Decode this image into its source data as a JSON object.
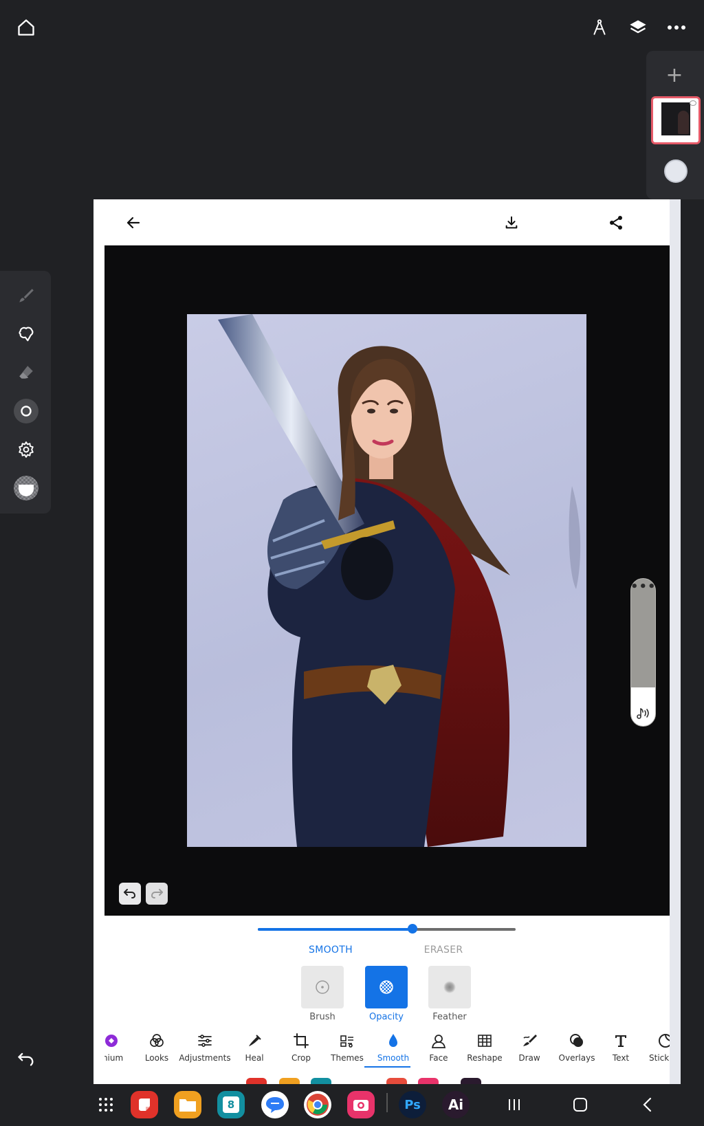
{
  "app": {
    "colors": {
      "accent": "#1473e6",
      "frame_bg": "#202124",
      "panel_bg": "#2b2c30",
      "thumb_border": "#e65a68"
    }
  },
  "top_bar": {
    "icons": [
      "home-icon",
      "compass-icon",
      "layers-icon",
      "more-icon"
    ]
  },
  "layer_panel": {
    "add_label": "+",
    "icons": [
      "plus-icon",
      "layer-thumbnail",
      "color-circle"
    ]
  },
  "left_tools": {
    "icons": [
      "brush-icon",
      "smudge-icon",
      "eraser-icon",
      "brush-size-icon",
      "settings-icon",
      "opacity-icon"
    ],
    "undo_icon": "undo-icon"
  },
  "editor": {
    "header_icons": [
      "back-arrow-icon",
      "download-icon",
      "share-icon"
    ],
    "history_icons": [
      "undo-icon",
      "redo-icon"
    ],
    "side_slider": {
      "menu_label": "•••",
      "level": 0.26,
      "icon": "sound-icon"
    },
    "smooth_slider": {
      "value": 0.6
    },
    "modes": {
      "smooth": "SMOOTH",
      "eraser": "ERASER",
      "selected": "smooth"
    },
    "options": [
      {
        "label": "Brush",
        "icon": "brush-circle-icon"
      },
      {
        "label": "Opacity",
        "icon": "opacity-checker-icon"
      },
      {
        "label": "Feather",
        "icon": "feather-dot-icon"
      }
    ],
    "selected_option": "Opacity",
    "tools": [
      {
        "label": "mium",
        "icon": "premium-icon"
      },
      {
        "label": "Looks",
        "icon": "looks-icon"
      },
      {
        "label": "Adjustments",
        "icon": "adjustments-icon"
      },
      {
        "label": "Heal",
        "icon": "heal-icon"
      },
      {
        "label": "Crop",
        "icon": "crop-icon"
      },
      {
        "label": "Themes",
        "icon": "themes-icon"
      },
      {
        "label": "Smooth",
        "icon": "smooth-drop-icon"
      },
      {
        "label": "Face",
        "icon": "face-icon"
      },
      {
        "label": "Reshape",
        "icon": "reshape-icon"
      },
      {
        "label": "Draw",
        "icon": "draw-icon"
      },
      {
        "label": "Overlays",
        "icon": "overlays-icon"
      },
      {
        "label": "Text",
        "icon": "text-icon"
      },
      {
        "label": "Stick",
        "icon": "sticker-icon"
      }
    ],
    "selected_tool": "Smooth"
  },
  "dock": {
    "apps": [
      {
        "name": "app-drawer",
        "icon": "grid-icon"
      },
      {
        "name": "app-notes",
        "color": "#e0322a"
      },
      {
        "name": "app-files",
        "color": "#f0a020"
      },
      {
        "name": "app-calendar",
        "color": "#128fa0",
        "label": "8"
      },
      {
        "name": "app-messages",
        "color": "#2e7cf6"
      },
      {
        "name": "app-chrome",
        "color": "#ffffff"
      },
      {
        "name": "app-camera",
        "color": "#e8336a"
      },
      {
        "name": "app-photoshop",
        "color": "#0d1e3a",
        "label": "Ps"
      },
      {
        "name": "app-illustrator",
        "color": "#2a1a2e",
        "label": "Ai"
      }
    ],
    "nav": [
      "recents-icon",
      "home-nav-icon",
      "back-nav-icon"
    ]
  }
}
